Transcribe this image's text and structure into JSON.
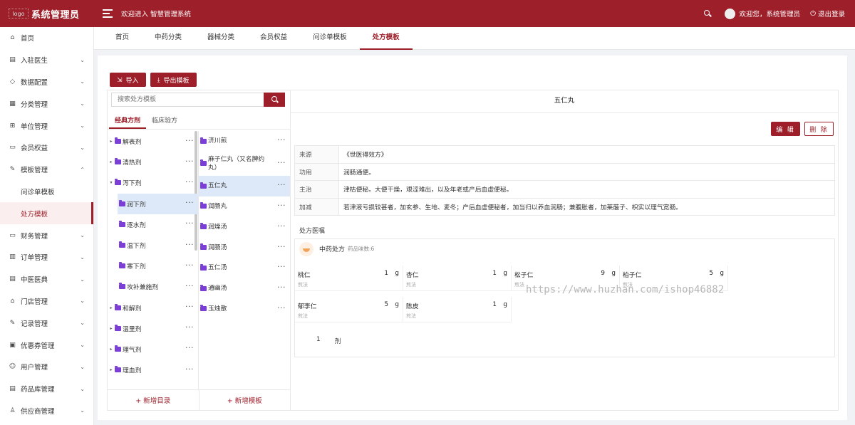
{
  "header": {
    "logo_alt": "logo",
    "title": "系统管理员",
    "welcome": "欢迎进入 智慧管理系统",
    "greeting": "欢迎您，系统管理员",
    "logout": "退出登录",
    "brand_color": "#9d1f2a"
  },
  "sidebar": {
    "items": [
      {
        "label": "首页",
        "icon": "home-icon"
      },
      {
        "label": "入驻医生",
        "icon": "doctor-icon"
      },
      {
        "label": "数据配置",
        "icon": "tag-icon"
      },
      {
        "label": "分类管理",
        "icon": "file-icon"
      },
      {
        "label": "单位管理",
        "icon": "box-icon"
      },
      {
        "label": "会员权益",
        "icon": "folder-icon"
      },
      {
        "label": "模板管理",
        "icon": "brush-icon"
      },
      {
        "label": "财务管理",
        "icon": "card-icon"
      },
      {
        "label": "订单管理",
        "icon": "barcode-icon"
      },
      {
        "label": "中医医典",
        "icon": "book-icon"
      },
      {
        "label": "门店管理",
        "icon": "shop-icon"
      },
      {
        "label": "记录管理",
        "icon": "edit-icon"
      },
      {
        "label": "优惠券管理",
        "icon": "coupon-icon"
      },
      {
        "label": "用户管理",
        "icon": "user-icon"
      },
      {
        "label": "药品库管理",
        "icon": "list-icon"
      },
      {
        "label": "供应商管理",
        "icon": "supplier-icon"
      }
    ],
    "template_sub": [
      "问诊单模板",
      "处方模板"
    ]
  },
  "tabs": [
    "首页",
    "中药分类",
    "器械分类",
    "会员权益",
    "问诊单模板",
    "处方模板"
  ],
  "toolbar": {
    "import": "导入",
    "export": "导出模板"
  },
  "search": {
    "placeholder": "搜索处方模板"
  },
  "sub_tabs": [
    "经典方剂",
    "临床验方"
  ],
  "categories": [
    {
      "label": "解表剂",
      "arrow": "▸"
    },
    {
      "label": "清热剂",
      "arrow": "▸"
    },
    {
      "label": "泻下剂",
      "arrow": "▾"
    },
    {
      "label": "润下剂",
      "child": true,
      "selected": true
    },
    {
      "label": "逐水剂",
      "child": true
    },
    {
      "label": "温下剂",
      "child": true
    },
    {
      "label": "寒下剂",
      "child": true
    },
    {
      "label": "攻补兼施剂",
      "child": true
    },
    {
      "label": "和解剂",
      "arrow": "▸"
    },
    {
      "label": "温里剂",
      "arrow": "▸"
    },
    {
      "label": "理气剂",
      "arrow": "▸"
    },
    {
      "label": "理血剂",
      "arrow": "▸"
    }
  ],
  "templates": [
    {
      "label": "济川煎"
    },
    {
      "label": "麻子仁丸（又名脾约丸）"
    },
    {
      "label": "五仁丸",
      "selected": true
    },
    {
      "label": "润肠丸"
    },
    {
      "label": "润燥汤"
    },
    {
      "label": "润肠汤"
    },
    {
      "label": "五仁汤"
    },
    {
      "label": "通幽汤"
    },
    {
      "label": "玉烛散"
    }
  ],
  "add": {
    "category": "+ 新增目录",
    "template": "+ 新增模板"
  },
  "detail": {
    "title": "五仁丸",
    "edit": "编 辑",
    "delete": "删 除",
    "rows": [
      {
        "k": "来源",
        "v": "《世医得效方》"
      },
      {
        "k": "功用",
        "v": "润肠通便。"
      },
      {
        "k": "主治",
        "v": "津枯便秘。大便干燥，艰涩难出，以及年老或产后血虚便秘。"
      },
      {
        "k": "加减",
        "v": "若津液亏损较甚者，加玄参、生地、麦冬；产后血虚便秘者，加当归以养血润肠；兼腹胀者，加莱菔子、枳实以理气宽肠。"
      }
    ],
    "section": "处方医嘱",
    "rx_name": "中药处方",
    "rx_count": "药品味数:6",
    "herbs": [
      {
        "name": "桃仁",
        "qty": "1",
        "unit": "g",
        "method": "煎法"
      },
      {
        "name": "杏仁",
        "qty": "1",
        "unit": "g",
        "method": "煎法"
      },
      {
        "name": "松子仁",
        "qty": "9",
        "unit": "g",
        "method": "煎法"
      },
      {
        "name": "柏子仁",
        "qty": "5",
        "unit": "g",
        "method": "煎法"
      },
      {
        "name": "郁李仁",
        "qty": "5",
        "unit": "g",
        "method": "煎法"
      },
      {
        "name": "陈皮",
        "qty": "1",
        "unit": "g",
        "method": "煎法"
      }
    ],
    "dose_num": "1",
    "dose_unit": "剂"
  },
  "watermark": "https://www.huzhan.com/ishop46882"
}
